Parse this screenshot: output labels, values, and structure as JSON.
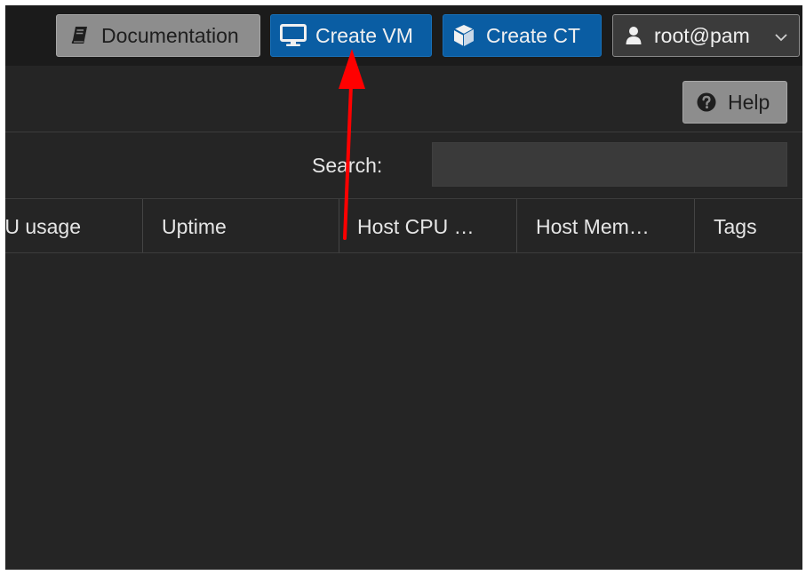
{
  "header": {
    "documentation_label": "Documentation",
    "create_vm_label": "Create VM",
    "create_ct_label": "Create CT",
    "user_label": "root@pam"
  },
  "toolbar": {
    "help_label": "Help"
  },
  "search": {
    "label": "Search:",
    "value": ""
  },
  "grid": {
    "columns": [
      "PU usage",
      "Uptime",
      "Host CPU …",
      "Host Mem…",
      "Tags"
    ]
  },
  "icons": {
    "documentation": "book-icon",
    "create_vm": "desktop-icon",
    "create_ct": "cube-icon",
    "user": "user-icon",
    "user_menu": "chevron-down-icon",
    "help": "question-circle-icon"
  },
  "colors": {
    "primary_button": "#0a5da3",
    "secondary_button": "#8d8d8d",
    "annotation_arrow": "#ff0000",
    "background": "#252525"
  }
}
